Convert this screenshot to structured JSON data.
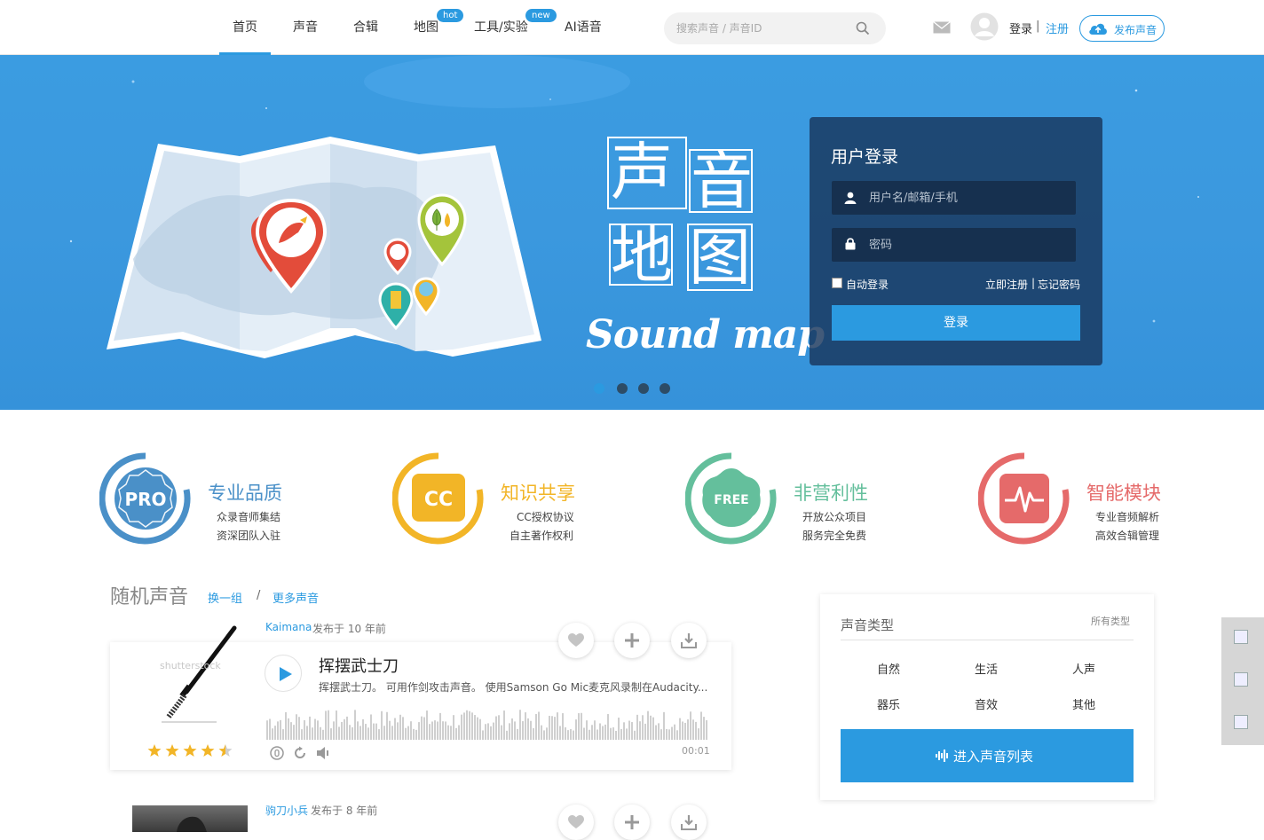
{
  "header": {
    "nav": [
      {
        "label": "首页",
        "active": true
      },
      {
        "label": "声音"
      },
      {
        "label": "合辑"
      },
      {
        "label": "地图",
        "badge": "hot"
      },
      {
        "label": "工具/实验",
        "badge": "new"
      },
      {
        "label": "AI语音"
      }
    ],
    "search_placeholder": "搜索声音 / 声音ID",
    "login_label": "登录",
    "separator": "|",
    "register_label": "注册",
    "publish_label": "发布声音"
  },
  "banner": {
    "title_chars": [
      "声",
      "音",
      "地",
      "图"
    ],
    "subtitle": "Sound map",
    "login": {
      "title": "用户登录",
      "username_placeholder": "用户名/邮箱/手机",
      "password_placeholder": "密码",
      "auto_login_label": "自动登录",
      "register_now": "立即注册",
      "links_sep": "|",
      "forgot_password": "忘记密码",
      "submit_label": "登录"
    },
    "slides": {
      "count": 4,
      "active": 0
    }
  },
  "features": [
    {
      "badge": "PRO",
      "title": "专业品质",
      "line1": "众录音师集结",
      "line2": "资深团队入驻",
      "color": "#4a90c8"
    },
    {
      "badge": "CC",
      "title": "知识共享",
      "line1": "CC授权协议",
      "line2": "自主著作权利",
      "color": "#f2b527"
    },
    {
      "badge": "FREE",
      "title": "非营利性",
      "line1": "开放公众项目",
      "line2": "服务完全免费",
      "color": "#64bf9c"
    },
    {
      "badge": "pulse",
      "title": "智能模块",
      "line1": "专业音频解析",
      "line2": "高效合辑管理",
      "color": "#e56a6a"
    }
  ],
  "random": {
    "title": "随机声音",
    "shuffle_label": "换一组",
    "sep": "/",
    "more_label": "更多声音",
    "sounds": [
      {
        "author": "Kaimana",
        "published": "发布于 10 年前",
        "title": "挥摆武士刀",
        "description": "挥摆武士刀。 可用作剑攻击声音。 使用Samson Go Mic麦克风录制在Audacity...",
        "duration": "00:01",
        "rating": 4.5,
        "thumb_watermark": "shutterstock"
      },
      {
        "author": "驹刀小兵",
        "published": "发布于 8 年前"
      }
    ]
  },
  "categories": {
    "title": "声音类型",
    "all_label": "所有类型",
    "items": [
      "自然",
      "生活",
      "人声",
      "器乐",
      "音效",
      "其他"
    ],
    "enter_label": "进入声音列表"
  }
}
